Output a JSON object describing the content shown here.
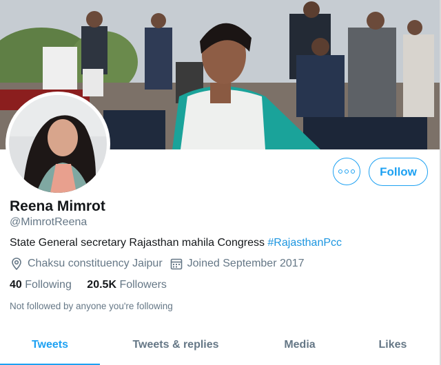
{
  "profile": {
    "name": "Reena Mimrot",
    "handle": "@MimrotReena",
    "bio_text": "State  General secretary Rajasthan mahila Congress ",
    "bio_hashtag": "#RajasthanPcc",
    "location": "Chaksu constituency Jaipur",
    "joined": "Joined September 2017",
    "following_count": "40",
    "following_label": "Following",
    "followers_count": "20.5K",
    "followers_label": "Followers",
    "not_followed_text": "Not followed by anyone you're following"
  },
  "actions": {
    "follow_label": "Follow",
    "more_icon": "more-icon"
  },
  "tabs": [
    {
      "label": "Tweets",
      "active": true
    },
    {
      "label": "Tweets & replies",
      "active": false
    },
    {
      "label": "Media",
      "active": false
    },
    {
      "label": "Likes",
      "active": false
    }
  ],
  "colors": {
    "accent": "#1da1f2",
    "muted_text": "#657786",
    "primary_text": "#14171a",
    "hashtag": "#1b95e0"
  },
  "icons": {
    "location": "location-pin-icon",
    "calendar": "calendar-icon"
  }
}
